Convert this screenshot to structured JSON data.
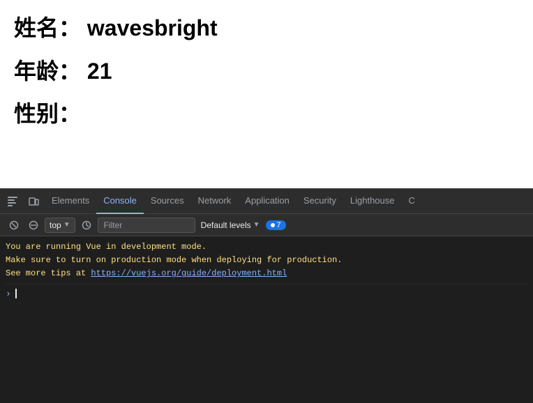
{
  "page": {
    "name_label": "姓名：",
    "name_value": "wavesbright",
    "age_label": "年龄：",
    "age_value": "21",
    "gender_label": "性别："
  },
  "devtools": {
    "tabs": [
      {
        "id": "elements",
        "label": "Elements",
        "active": false
      },
      {
        "id": "console",
        "label": "Console",
        "active": true
      },
      {
        "id": "sources",
        "label": "Sources",
        "active": false
      },
      {
        "id": "network",
        "label": "Network",
        "active": false
      },
      {
        "id": "application",
        "label": "Application",
        "active": false
      },
      {
        "id": "security",
        "label": "Security",
        "active": false
      },
      {
        "id": "lighthouse",
        "label": "Lighthouse",
        "active": false
      }
    ],
    "toolbar": {
      "context": "top",
      "filter_placeholder": "Filter",
      "levels_label": "Default levels",
      "message_count": "7"
    },
    "console_lines": [
      "You are running Vue in development mode.",
      "Make sure to turn on production mode when deploying for production.",
      "See more tips at "
    ],
    "console_link": "https://vuejs.org/guide/deployment.html",
    "console_link_text": "https://vuejs.org/guide/deployment.html"
  }
}
